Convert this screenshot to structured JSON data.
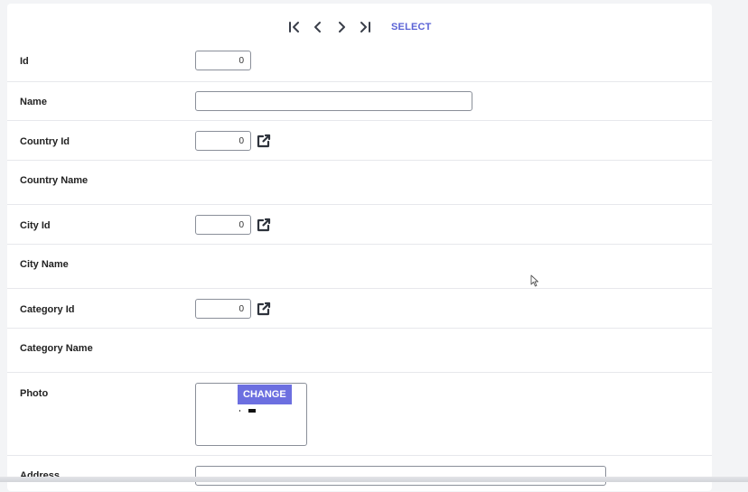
{
  "toolbar": {
    "first_icon": "first-page-icon",
    "prev_icon": "chevron-left-icon",
    "next_icon": "chevron-right-icon",
    "last_icon": "last-page-icon",
    "select_label": "SELECT"
  },
  "fields": {
    "id": {
      "label": "Id",
      "value": "0"
    },
    "name": {
      "label": "Name",
      "value": ""
    },
    "country_id": {
      "label": "Country Id",
      "value": "0",
      "link_icon": "open-external-icon"
    },
    "country_name": {
      "label": "Country Name"
    },
    "city_id": {
      "label": "City Id",
      "value": "0",
      "link_icon": "open-external-icon"
    },
    "city_name": {
      "label": "City Name"
    },
    "category_id": {
      "label": "Category Id",
      "value": "0",
      "link_icon": "open-external-icon"
    },
    "category_name": {
      "label": "Category Name"
    },
    "photo": {
      "label": "Photo",
      "change_label": "CHANGE"
    },
    "address": {
      "label": "Address",
      "value": ""
    }
  },
  "colors": {
    "accent": "#6c6fe0",
    "select_text": "#5b63d6",
    "background": "#f3f4f6"
  }
}
